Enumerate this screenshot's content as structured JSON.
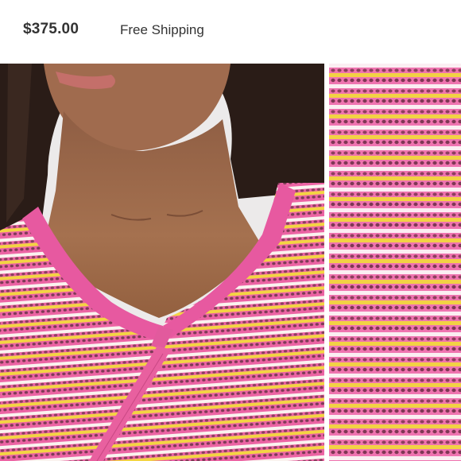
{
  "listing": {
    "price": "$375.00",
    "shipping": "Free Shipping"
  },
  "images": {
    "main": {
      "subject": "model-wearing-pink-striped-crochet-knit-top"
    },
    "detail": {
      "subject": "knit-texture-close-up"
    }
  },
  "colors": {
    "knit_pink": "#ec64a4",
    "knit_yellow": "#f3d443",
    "knit_white": "#faf3ef",
    "skin": "#9c6a4d",
    "hair": "#2a1c17",
    "background": "#eceaea"
  }
}
